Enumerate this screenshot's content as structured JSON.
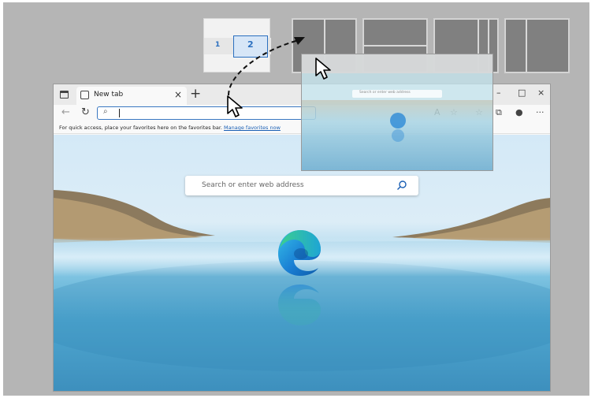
{
  "snap_layouts": {
    "layout1": {
      "zone1_label": "1",
      "zone2_label": "2"
    }
  },
  "browser": {
    "tab": {
      "title": "New tab",
      "icon": "new-tab-page-icon"
    },
    "new_tab_symbol": "+",
    "window_controls": {
      "minimize": "–",
      "maximize": "□",
      "close": "×"
    },
    "favorites_bar": {
      "message": "For quick access, place your favorites here on the favorites bar.",
      "link": "Manage favorites now"
    },
    "search": {
      "placeholder": "Search or enter web address"
    }
  },
  "ghost_preview": {
    "search_placeholder": "Search or enter web address"
  },
  "colors": {
    "accent": "#3a78c2",
    "link": "#1a5fb4",
    "desktop_bg": "#b5b5b5"
  }
}
